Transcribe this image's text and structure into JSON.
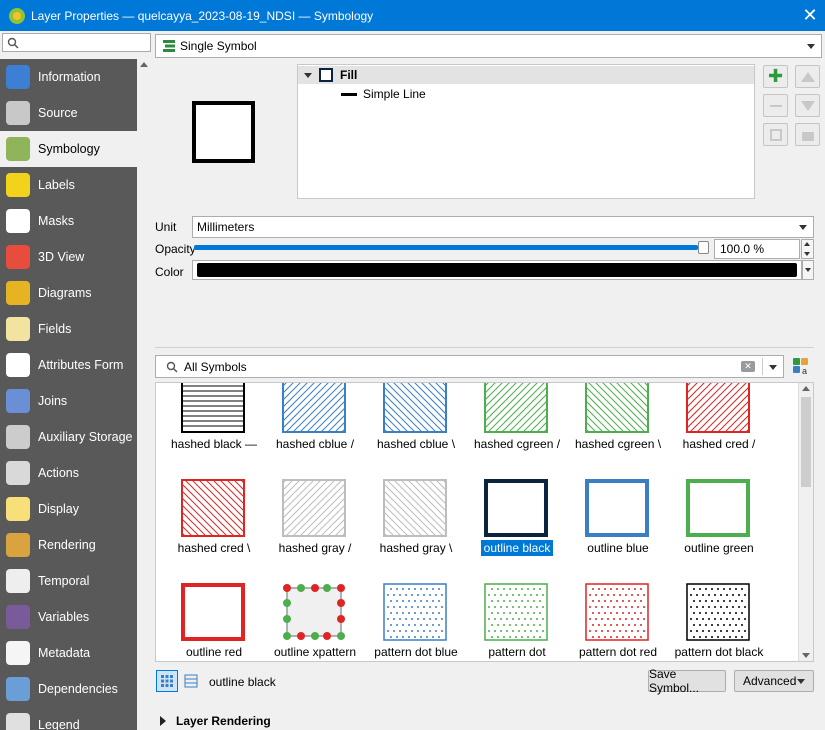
{
  "window": {
    "title": "Layer Properties — quelcayya_2023-08-19_NDSI — Symbology"
  },
  "sidebar": {
    "items": [
      {
        "label": "Information",
        "icon": "information-icon",
        "color": "#3d7fd4"
      },
      {
        "label": "Source",
        "icon": "source-icon",
        "color": "#c8c8c8"
      },
      {
        "label": "Symbology",
        "icon": "symbology-icon",
        "color": "#8fb45a"
      },
      {
        "label": "Labels",
        "icon": "labels-icon",
        "color": "#f2d21b"
      },
      {
        "label": "Masks",
        "icon": "masks-icon",
        "color": "#ffffff"
      },
      {
        "label": "3D View",
        "icon": "3d-view-icon",
        "color": "#e74c3c"
      },
      {
        "label": "Diagrams",
        "icon": "diagrams-icon",
        "color": "#e6b422"
      },
      {
        "label": "Fields",
        "icon": "fields-icon",
        "color": "#f3e3a0"
      },
      {
        "label": "Attributes Form",
        "icon": "attributes-form-icon",
        "color": "#ffffff"
      },
      {
        "label": "Joins",
        "icon": "joins-icon",
        "color": "#6b8fd6"
      },
      {
        "label": "Auxiliary Storage",
        "icon": "auxiliary-storage-icon",
        "color": "#cccccc"
      },
      {
        "label": "Actions",
        "icon": "actions-icon",
        "color": "#d9d9d9"
      },
      {
        "label": "Display",
        "icon": "display-icon",
        "color": "#f7e07a"
      },
      {
        "label": "Rendering",
        "icon": "rendering-icon",
        "color": "#d9a440"
      },
      {
        "label": "Temporal",
        "icon": "temporal-icon",
        "color": "#eeeeee"
      },
      {
        "label": "Variables",
        "icon": "variables-icon",
        "color": "#7a5b9a"
      },
      {
        "label": "Metadata",
        "icon": "metadata-icon",
        "color": "#f5f5f5"
      },
      {
        "label": "Dependencies",
        "icon": "dependencies-icon",
        "color": "#6a9ed6"
      },
      {
        "label": "Legend",
        "icon": "legend-icon",
        "color": "#e0e0e0"
      }
    ]
  },
  "renderer": {
    "value": "Single Symbol"
  },
  "symbol_tree": {
    "fill_label": "Fill",
    "line_label": "Simple Line"
  },
  "properties": {
    "unit_label": "Unit",
    "unit_value": "Millimeters",
    "opacity_label": "Opacity",
    "opacity_value": "100.0 %",
    "opacity_fraction": 1.0,
    "color_label": "Color",
    "color_value": "#000000"
  },
  "library": {
    "search_value": "All Symbols",
    "symbols": [
      {
        "name": "hashed black —",
        "kind": "hline",
        "color": "#000000"
      },
      {
        "name": "hashed cblue /",
        "kind": "fwd",
        "color": "#3a7fc4"
      },
      {
        "name": "hashed cblue \\",
        "kind": "back",
        "color": "#3a7fc4"
      },
      {
        "name": "hashed cgreen /",
        "kind": "fwd",
        "color": "#4cae4c"
      },
      {
        "name": "hashed cgreen \\",
        "kind": "back",
        "color": "#4cae4c"
      },
      {
        "name": "hashed cred /",
        "kind": "fwd",
        "color": "#e02424"
      },
      {
        "name": "hashed cred \\",
        "kind": "back",
        "color": "#e02424"
      },
      {
        "name": "hashed gray /",
        "kind": "fwd",
        "color": "#bdbdbd"
      },
      {
        "name": "hashed gray \\",
        "kind": "back",
        "color": "#bdbdbd"
      },
      {
        "name": "outline black",
        "kind": "outline",
        "color": "#0a2440",
        "selected": true
      },
      {
        "name": "outline blue",
        "kind": "outline",
        "color": "#3a7fc4"
      },
      {
        "name": "outline green",
        "kind": "outline",
        "color": "#4cae4c"
      },
      {
        "name": "outline red",
        "kind": "outline",
        "color": "#e02424"
      },
      {
        "name": "outline xpattern",
        "kind": "xpattern",
        "color": "#e02424"
      },
      {
        "name": "pattern dot  blue",
        "kind": "dot",
        "color": "#3a7fc4"
      },
      {
        "name": "pattern dot",
        "kind": "dot",
        "color": "#4cae4c"
      },
      {
        "name": "pattern dot  red",
        "kind": "dot",
        "color": "#e02424"
      },
      {
        "name": "pattern dot black",
        "kind": "dot",
        "color": "#000000"
      }
    ],
    "selected_name": "outline black",
    "save_button": "Save Symbol...",
    "advanced_button": "Advanced"
  },
  "layer_rendering": {
    "label": "Layer Rendering"
  }
}
